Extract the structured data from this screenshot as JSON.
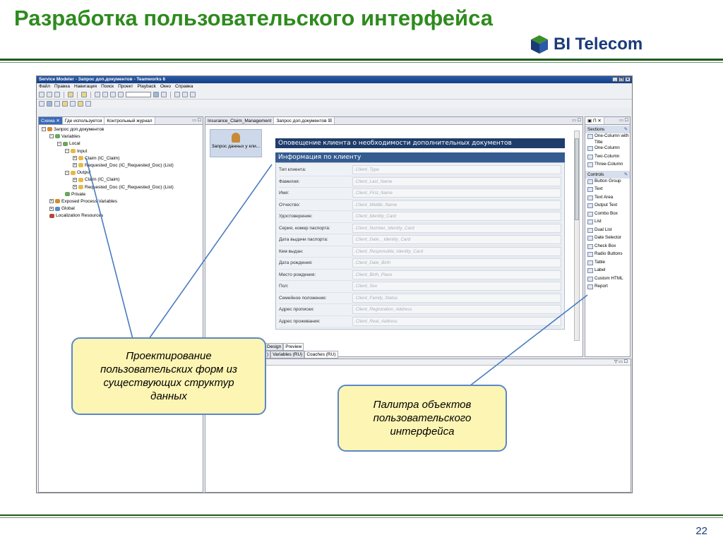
{
  "slide": {
    "title": "Разработка пользовательского интерфейса",
    "logo": "BI Telecom",
    "page_number": "22"
  },
  "app": {
    "window_title": "Service Modeler - Запрос доп.документов - Teamworks 6",
    "window_buttons": [
      "_",
      "❐",
      "✕"
    ],
    "menu": [
      "Файл",
      "Правка",
      "Навигация",
      "Поиск",
      "Проект",
      "Playback",
      "Окно",
      "Справка"
    ]
  },
  "left_pane": {
    "tabs": [
      "Схема",
      "Где используется",
      "Контрольный журнал"
    ],
    "tree": [
      {
        "label": "Запрос доп.документов",
        "level": 0,
        "toggle": "⊟",
        "icon": "o"
      },
      {
        "label": "Variables",
        "level": 1,
        "toggle": "⊟",
        "icon": "g"
      },
      {
        "label": "Local",
        "level": 2,
        "toggle": "⊟",
        "icon": "g"
      },
      {
        "label": "Input",
        "level": 3,
        "toggle": "⊟",
        "icon": "f"
      },
      {
        "label": "Claim (IC_Claim)",
        "level": 4,
        "toggle": "⊞",
        "icon": "f"
      },
      {
        "label": "Requested_Doc (IC_Requested_Doc) (List)",
        "level": 4,
        "toggle": "⊞",
        "icon": "f"
      },
      {
        "label": "Output",
        "level": 3,
        "toggle": "⊟",
        "icon": "f"
      },
      {
        "label": "Claim (IC_Claim)",
        "level": 4,
        "toggle": "⊞",
        "icon": "f"
      },
      {
        "label": "Requested_Doc (IC_Requested_Doc) (List)",
        "level": 4,
        "toggle": "⊞",
        "icon": "f"
      },
      {
        "label": "Private",
        "level": 3,
        "toggle": "",
        "icon": "g"
      },
      {
        "label": "Exposed Process Variables",
        "level": 1,
        "toggle": "⊞",
        "icon": "o"
      },
      {
        "label": "Global",
        "level": 1,
        "toggle": "⊞",
        "icon": "b"
      },
      {
        "label": "Localization Resources",
        "level": 1,
        "toggle": "",
        "icon": "r"
      }
    ]
  },
  "editor": {
    "tabs": [
      "Insurance_Claim_Management",
      "Запрос доп.документов"
    ],
    "coach_label": "Запрос данных у кли...",
    "header1": "Оповещение клиента о необходимости дополнительных документов",
    "header2": "Информация по клиенту",
    "fields": [
      {
        "label": "Тип клиента:",
        "value": ".Client_Type"
      },
      {
        "label": "Фамилия:",
        "value": ".Client_Last_Name"
      },
      {
        "label": "Имя:",
        "value": ".Client_First_Name"
      },
      {
        "label": "Отчество:",
        "value": ".Client_Middle_Name"
      },
      {
        "label": "Удостоверение:",
        "value": ".Client_Identity_Card"
      },
      {
        "label": "Серия, номер паспорта:",
        "value": ".Client_Number_Identity_Card"
      },
      {
        "label": "Дата выдачи паспорта:",
        "value": ".Client_Date__Identity_Card"
      },
      {
        "label": "Кем выдан:",
        "value": ".Client_Responsible_Identity_Card"
      },
      {
        "label": "Дата рождения:",
        "value": ".Client_Date_Birth"
      },
      {
        "label": "Место рождения:",
        "value": ".Client_Birth_Place"
      },
      {
        "label": "Пол:",
        "value": ".Client_Sex"
      },
      {
        "label": "Семейное положение:",
        "value": ".Client_Family_Status"
      },
      {
        "label": "Адрес прописки:",
        "value": ".Client_Registration_Address"
      },
      {
        "label": "Адрес проживания:",
        "value": ".Client_Real_Address"
      }
    ],
    "view_tabs": [
      "Design",
      "Preview"
    ],
    "resource_tabs": [
      ")",
      "Variables (RU)",
      "Coaches (RU)"
    ]
  },
  "palette": {
    "tab_label": "П",
    "sections_header": "Sections",
    "sections": [
      "One-Column with Title",
      "One-Column",
      "Two-Column",
      "Three-Column"
    ],
    "controls_header": "Controls",
    "controls": [
      "Button Group",
      "Text",
      "Text Area",
      "Output Text",
      "Combo Box",
      "List",
      "Dual List",
      "Date Selector",
      "Check Box",
      "Radio Buttons",
      "Table",
      "Label",
      "Custom HTML",
      "Report"
    ]
  },
  "callouts": {
    "left": "Проектирование пользовательских форм из существующих структур данных",
    "right": "Палитра объектов пользовательского интерфейса"
  },
  "colors": {
    "title_green": "#2e8b1e",
    "logo_blue": "#1a3a78",
    "callout_fill": "#fdf5b3",
    "callout_border": "#5a87c8",
    "section_header": "#1e3d6b"
  }
}
